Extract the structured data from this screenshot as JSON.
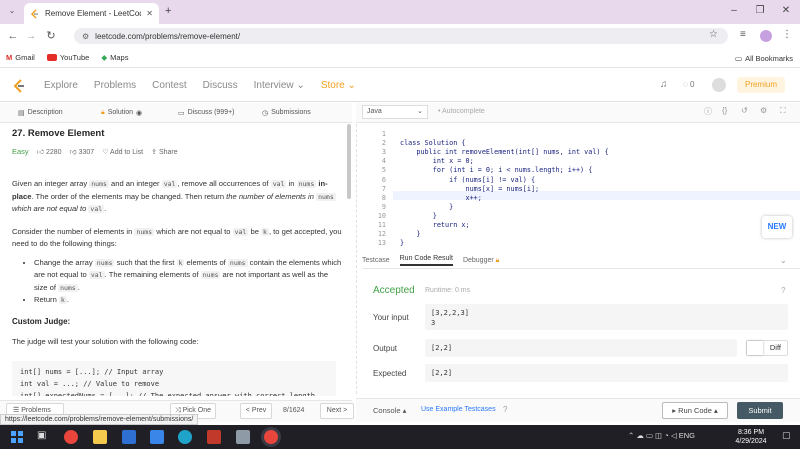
{
  "browser": {
    "tab_title": "Remove Element - LeetCode",
    "url": "leetcode.com/problems/remove-element/",
    "bookmarks": [
      "Gmail",
      "YouTube",
      "Maps"
    ],
    "all_bookmarks": "All Bookmarks",
    "status_url": "https://leetcode.com/problems/remove-element/submissions/"
  },
  "nav": {
    "items": [
      "Explore",
      "Problems",
      "Contest",
      "Discuss",
      "Interview",
      "Store"
    ],
    "notif_count": "0",
    "premium": "Premium"
  },
  "left_tabs": [
    "Description",
    "Solution",
    "Discuss (999+)",
    "Submissions"
  ],
  "problem": {
    "title": "27. Remove Element",
    "difficulty": "Easy",
    "likes": "2280",
    "dislikes": "3307",
    "add_to_list": "Add to List",
    "share": "Share",
    "p1_a": "Given an integer array ",
    "p1_nums": "nums",
    "p1_b": " and an integer ",
    "p1_val": "val",
    "p1_c": ", remove all occurrences of ",
    "p1_val2": "val",
    "p1_d": " in ",
    "p1_nums2": "nums",
    "p1_inplace": " in-place",
    "p1_e": ". The order of the elements may be changed. Then return ",
    "p1_f": "the number of elements in ",
    "p1_nums3": "nums",
    "p1_g": " which are not equal to ",
    "p1_val3": "val",
    "p1_h": ".",
    "p2_a": "Consider the number of elements in ",
    "p2_nums": "nums",
    "p2_b": " which are not equal to ",
    "p2_val": "val",
    "p2_c": " be ",
    "p2_k": "k",
    "p2_d": ", to get accepted, you need to do the following things:",
    "b1_a": "Change the array ",
    "b1_nums": "nums",
    "b1_b": " such that the first ",
    "b1_k": "k",
    "b1_c": " elements of ",
    "b1_nums2": "nums",
    "b1_d": " contain the elements which are not equal to ",
    "b1_val": "val",
    "b1_e": ". The remaining elements of ",
    "b1_nums3": "nums",
    "b1_f": " are not important as well as the size of ",
    "b1_nums4": "nums",
    "b1_g": ".",
    "b2_a": "Return ",
    "b2_k": "k",
    "b2_b": ".",
    "custom_judge": "Custom Judge:",
    "judge_text": "The judge will test your solution with the following code:",
    "judge_code": "int[] nums = [...]; // Input array\nint val = ...; // Value to remove\nint[] expectedNums = [...]; // The expected answer with correct length."
  },
  "left_bottom": {
    "problems": "Problems",
    "pick_one": "Pick One",
    "prev": "< Prev",
    "page": "8/1624",
    "next": "Next >"
  },
  "editor": {
    "language": "Java",
    "autocomplete": "Autocomplete",
    "lines": [
      "",
      "class Solution {",
      "    public int removeElement(int[] nums, int val) {",
      "        int x = 0;",
      "        for (int i = 0; i < nums.length; i++) {",
      "            if (nums[i] != val) {",
      "                nums[x] = nums[i];",
      "                x++;",
      "            }",
      "        }",
      "        return x;",
      "    }",
      "}"
    ],
    "line_numbers": [
      "1",
      "2",
      "3",
      "4",
      "5",
      "6",
      "7",
      "8",
      "9",
      "10",
      "11",
      "12",
      "13"
    ],
    "new_badge": "NEW"
  },
  "result": {
    "tabs": [
      "Testcase",
      "Run Code Result",
      "Debugger"
    ],
    "status": "Accepted",
    "runtime": "Runtime: 0 ms",
    "your_input_label": "Your input",
    "your_input": "[3,2,2,3]\n3",
    "output_label": "Output",
    "output": "[2,2]",
    "expected_label": "Expected",
    "expected": "[2,2]",
    "diff": "Diff"
  },
  "right_bottom": {
    "console": "Console",
    "use_example": "Use Example Testcases",
    "run_code": "Run Code",
    "submit": "Submit"
  },
  "taskbar": {
    "lang": "ENG",
    "time": "8:36 PM",
    "date": "4/29/2024"
  },
  "colors": {
    "accent_green": "#43a047",
    "submit_bg": "#455a64",
    "premium": "#f0a020"
  }
}
